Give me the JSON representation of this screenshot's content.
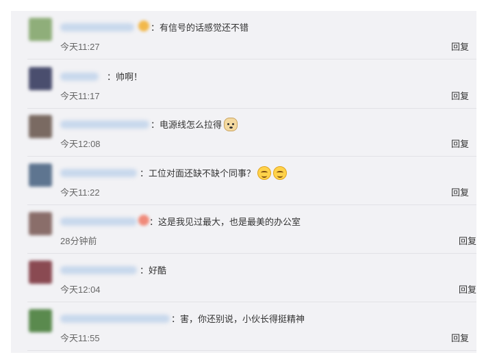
{
  "comments": [
    {
      "name_placeholder": "blurred-username",
      "text": "：有信号的话感觉还不错",
      "time": "今天11:27",
      "reply": "回复",
      "avatar_color": "#8fae7a",
      "has_name_emoji": true,
      "name_emoji_color": "#f2b84b"
    },
    {
      "name_placeholder": "blurred-username",
      "text": "：帅啊！",
      "time": "今天11:17",
      "reply": "回复",
      "avatar_color": "#4a4e6e",
      "has_name_emoji": false
    },
    {
      "name_placeholder": "blurred-username",
      "text": "：电源线怎么拉得",
      "time": "今天12:08",
      "reply": "回复",
      "avatar_color": "#7a6a62",
      "has_name_emoji": false,
      "emoji": "doge"
    },
    {
      "name_placeholder": "blurred-username",
      "text": "：工位对面还缺不缺个同事？",
      "time": "今天11:22",
      "reply": "回复",
      "avatar_color": "#5e7590",
      "has_name_emoji": false,
      "emoji": "smiley-x2"
    },
    {
      "name_placeholder": "blurred-username",
      "text": "：这是我见过最大，也是最美的办公室",
      "time": "28分钟前",
      "reply": "回复",
      "avatar_color": "#8a6e6a",
      "has_name_emoji": true,
      "name_emoji_color": "#f08a7a"
    },
    {
      "name_placeholder": "blurred-username",
      "text": "：好酷",
      "time": "今天12:04",
      "reply": "回复",
      "avatar_color": "#8a4a52",
      "has_name_emoji": false
    },
    {
      "name_placeholder": "blurred-username",
      "text": "：害，你还别说，小伙长得挺精神",
      "time": "今天11:55",
      "reply": "回复",
      "avatar_color": "#5a8a4e",
      "has_name_emoji": false
    }
  ]
}
